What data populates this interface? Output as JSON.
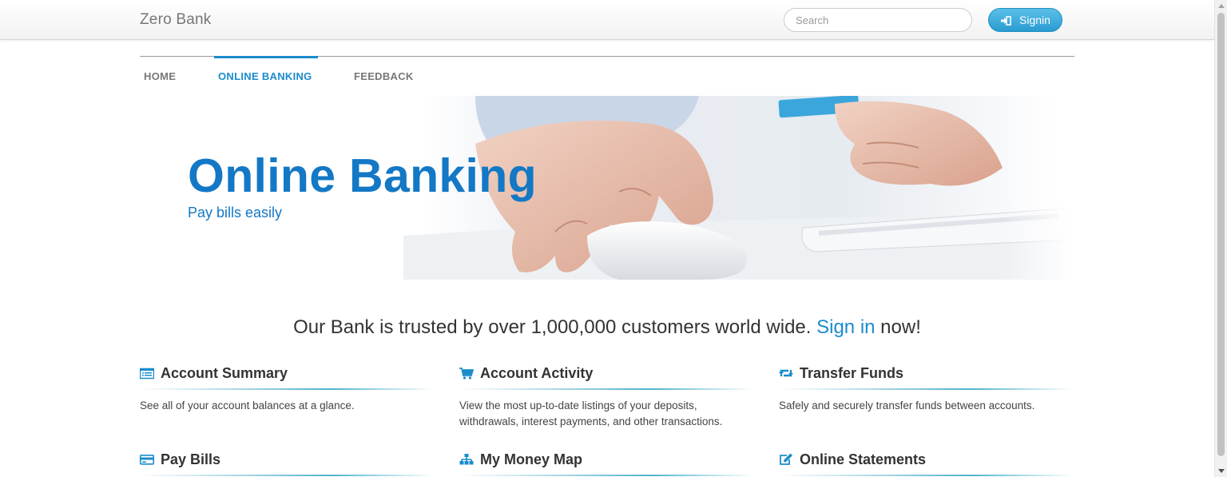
{
  "header": {
    "brand": "Zero Bank",
    "search_placeholder": "Search",
    "signin_label": "Signin"
  },
  "nav": {
    "tabs": [
      {
        "label": "HOME",
        "active": false
      },
      {
        "label": "ONLINE BANKING",
        "active": true
      },
      {
        "label": "FEEDBACK",
        "active": false
      }
    ]
  },
  "hero": {
    "title": "Online Banking",
    "subtitle": "Pay bills easily"
  },
  "trust": {
    "before": "Our Bank is trusted by over 1,000,000 customers world wide. ",
    "link": "Sign in",
    "after": " now!"
  },
  "features": [
    {
      "title": "Account Summary",
      "icon": "list-icon",
      "desc": "See all of your account balances at a glance."
    },
    {
      "title": "Account Activity",
      "icon": "cart-icon",
      "desc": "View the most up-to-date listings of your deposits, withdrawals, interest payments, and other transactions."
    },
    {
      "title": "Transfer Funds",
      "icon": "retweet-icon",
      "desc": "Safely and securely transfer funds between accounts."
    },
    {
      "title": "Pay Bills",
      "icon": "credit-card-icon",
      "desc": ""
    },
    {
      "title": "My Money Map",
      "icon": "sitemap-icon",
      "desc": ""
    },
    {
      "title": "Online Statements",
      "icon": "edit-icon",
      "desc": ""
    }
  ],
  "colors": {
    "accent": "#1a8ccc",
    "hero_text": "#1378c5",
    "signin_button": "#2a9bd1"
  }
}
